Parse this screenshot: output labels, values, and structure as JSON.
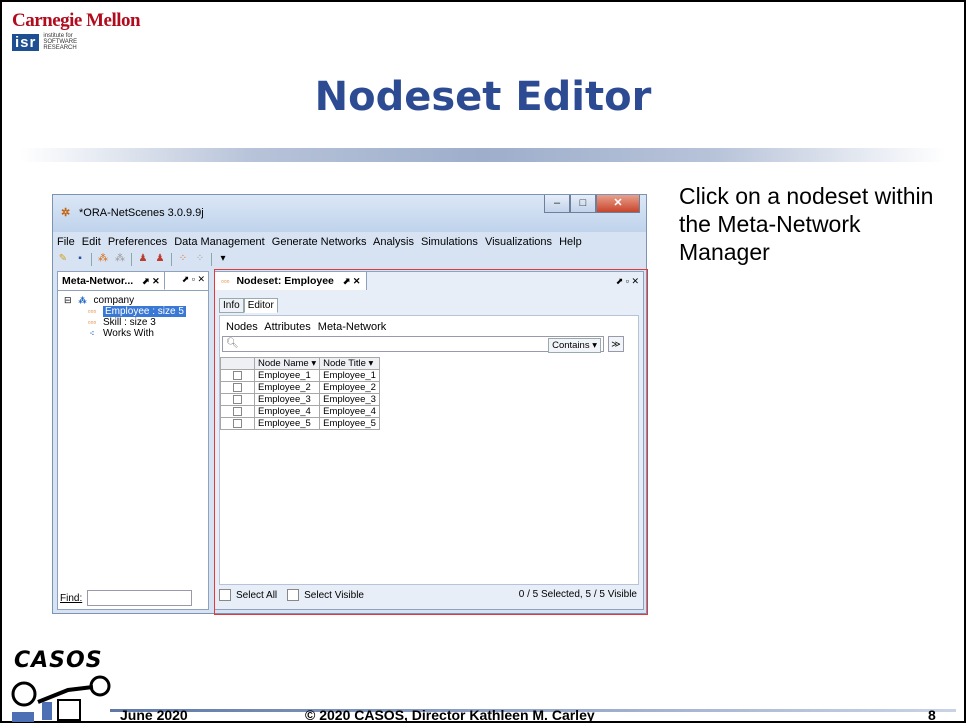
{
  "branding": {
    "university": "Carnegie Mellon",
    "institute_mark": "isr",
    "institute_text": [
      "institute for",
      "SOFTWARE",
      "RESEARCH"
    ]
  },
  "slide": {
    "title": "Nodeset Editor",
    "side_text": "Click on a nodeset within the Meta-Network Manager"
  },
  "window": {
    "title": "*ORA-NetScenes 3.0.9.9j",
    "menu": [
      "File",
      "Edit",
      "Preferences",
      "Data Management",
      "Generate Networks",
      "Analysis",
      "Simulations",
      "Visualizations",
      "Help"
    ],
    "minimize": "–",
    "maximize": "□",
    "close": "✕"
  },
  "left_panel": {
    "tab_label": "Meta-Networ...",
    "tab_controls": "⬈ ✕",
    "panel_controls": "⬈ ▫ ✕",
    "tree": {
      "root": "company",
      "items": [
        {
          "label": "Employee : size 5",
          "icon": "nodeset-icon",
          "selected": true
        },
        {
          "label": "Skill : size 3",
          "icon": "nodeset-icon",
          "selected": false
        },
        {
          "label": "Works With",
          "icon": "network-icon",
          "selected": false
        }
      ]
    },
    "find_label": "Find:",
    "find_value": ""
  },
  "editor": {
    "tab_label": "Nodeset: Employee",
    "tab_controls": "⬈ ✕",
    "panel_controls": "⬈ ▫ ✕",
    "subtabs": [
      "Info",
      "Editor"
    ],
    "active_subtab": "Editor",
    "submenu": [
      "Nodes",
      "Attributes",
      "Meta-Network"
    ],
    "search_value": "",
    "search_mode": "Contains ▾",
    "expand": "≫",
    "columns": [
      "Node Name ▾",
      "Node Title ▾"
    ],
    "rows": [
      {
        "name": "Employee_1",
        "title": "Employee_1"
      },
      {
        "name": "Employee_2",
        "title": "Employee_2"
      },
      {
        "name": "Employee_3",
        "title": "Employee_3"
      },
      {
        "name": "Employee_4",
        "title": "Employee_4"
      },
      {
        "name": "Employee_5",
        "title": "Employee_5"
      }
    ],
    "select_all": "Select All",
    "select_visible": "Select Visible",
    "status": "0 / 5 Selected, 5 / 5 Visible"
  },
  "footer": {
    "logo": "CASOS",
    "date": "June 2020",
    "copyright": "© 2020 CASOS, Director Kathleen M. Carley",
    "page": "8"
  }
}
